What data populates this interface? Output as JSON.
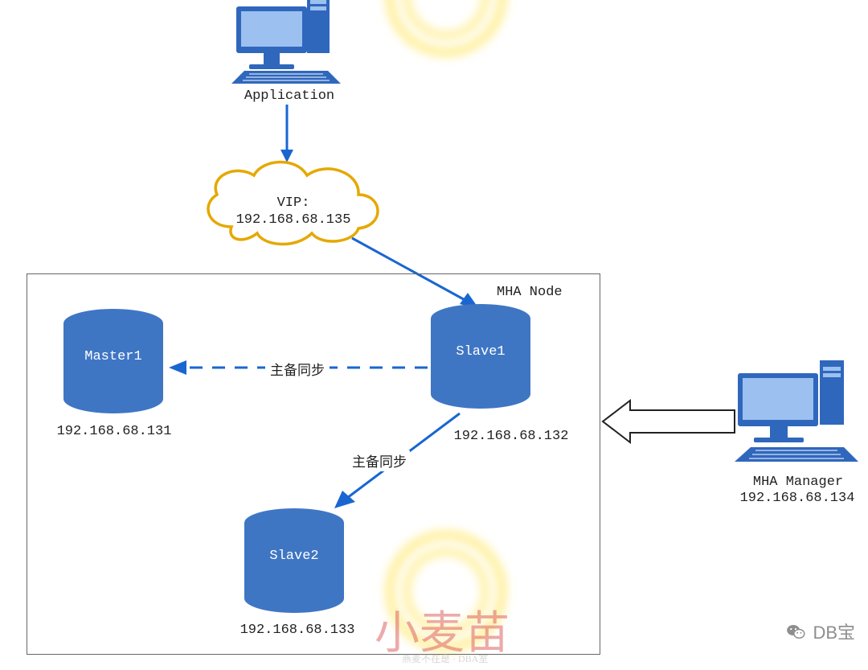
{
  "application_label": "Application",
  "vip": {
    "title": "VIP:",
    "ip": "192.168.68.135"
  },
  "mha_node_box_label": "MHA Node",
  "master1": {
    "name": "Master1",
    "ip": "192.168.68.131"
  },
  "slave1": {
    "name": "Slave1",
    "ip": "192.168.68.132"
  },
  "slave2": {
    "name": "Slave2",
    "ip": "192.168.68.133"
  },
  "sync_label_a": "主备同步",
  "sync_label_b": "主备同步",
  "mha_manager": {
    "name": "MHA Manager",
    "ip": "192.168.68.134"
  },
  "watermark_main": "小麦苗",
  "watermark_sub": "燕麦不在是 · DBA室",
  "brand": "DB宝",
  "colors": {
    "node": "#3f76c4",
    "arrow": "#1a66d1",
    "cloud": "#e5a800",
    "box": "#666"
  }
}
